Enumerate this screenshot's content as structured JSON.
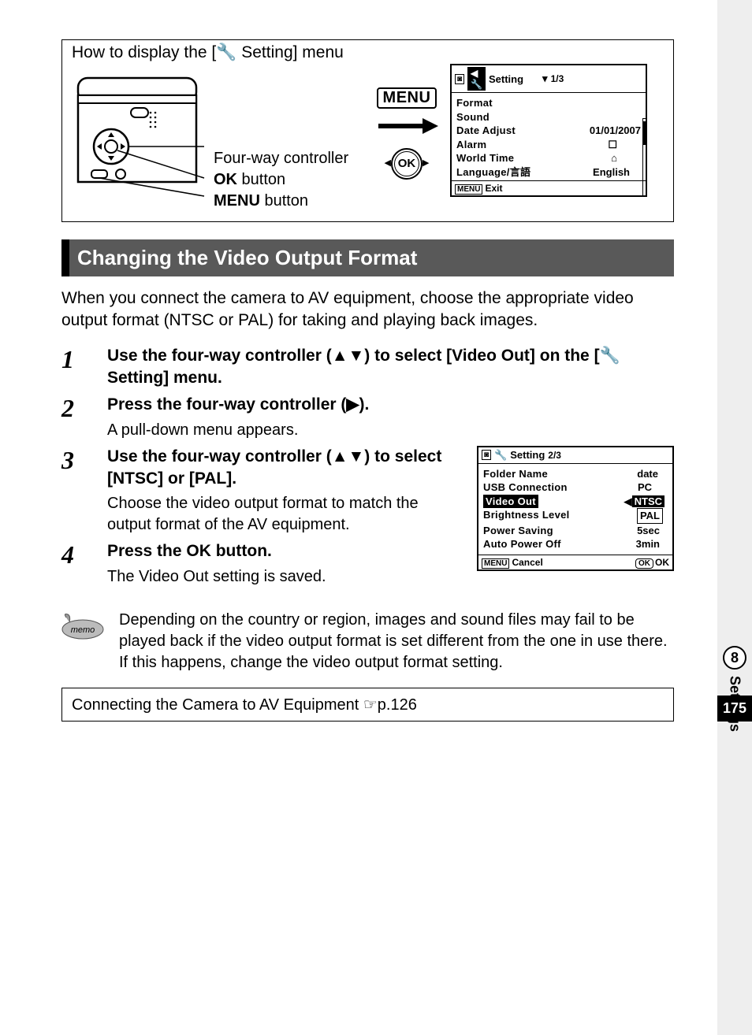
{
  "sideTab": {
    "chapterNumber": "8",
    "label": "Settings"
  },
  "pageNumber": "175",
  "howto": {
    "title": "How to display the [🔧 Setting] menu",
    "labels": {
      "fourWay": "Four-way controller",
      "okButtonBold": "OK",
      "okButtonText": " button",
      "menuButtonBold": "MENU",
      "menuButtonText": " button"
    },
    "menuBadge": "MENU",
    "okBadge": "OK"
  },
  "lcd1": {
    "header": {
      "title": "Setting",
      "page": "1/3"
    },
    "rows": [
      {
        "label": "Format",
        "value": ""
      },
      {
        "label": "Sound",
        "value": ""
      },
      {
        "label": "Date Adjust",
        "value": "01/01/2007"
      },
      {
        "label": "Alarm",
        "value": "☐"
      },
      {
        "label": "World Time",
        "value": "⌂"
      },
      {
        "label": "Language/言語",
        "value": "English"
      }
    ],
    "footer": {
      "left": "Exit"
    }
  },
  "heading": "Changing the Video Output Format",
  "intro": "When you connect the camera to AV equipment, choose the appropriate video output format (NTSC or PAL) for taking and playing back images.",
  "steps": [
    {
      "num": "1",
      "title": "Use the four-way controller (▲▼) to select [Video Out] on the [🔧Setting] menu."
    },
    {
      "num": "2",
      "title": "Press the four-way controller (▶).",
      "sub": "A pull-down menu appears."
    },
    {
      "num": "3",
      "title": "Use the four-way controller (▲▼) to select [NTSC] or [PAL].",
      "sub": "Choose the video output format to match the output format of the AV equipment."
    },
    {
      "num": "4",
      "titlePrefix": "Press the ",
      "titleOK": "OK",
      "titleSuffix": " button.",
      "sub": "The Video Out setting is saved."
    }
  ],
  "lcd2": {
    "header": {
      "title": "Setting",
      "page": "2/3"
    },
    "rows": [
      {
        "label": "Folder Name",
        "value": "date"
      },
      {
        "label": "USB Connection",
        "value": "PC"
      },
      {
        "label": "Video Out",
        "value": "NTSC",
        "highlight": true,
        "dropdown": true
      },
      {
        "label": "Brightness Level",
        "value": "PAL",
        "boxed": true
      },
      {
        "label": "Power Saving",
        "value": "5sec"
      },
      {
        "label": "Auto Power Off",
        "value": "3min"
      }
    ],
    "footer": {
      "left": "Cancel",
      "right": "OK"
    }
  },
  "memo": {
    "label": "memo",
    "text": "Depending on the country or region, images and sound files may fail to be played back if the video output format is set different from the one in use there. If this happens, change the video output format setting."
  },
  "refBox": {
    "text": "Connecting the Camera to AV Equipment ☞p.126"
  }
}
